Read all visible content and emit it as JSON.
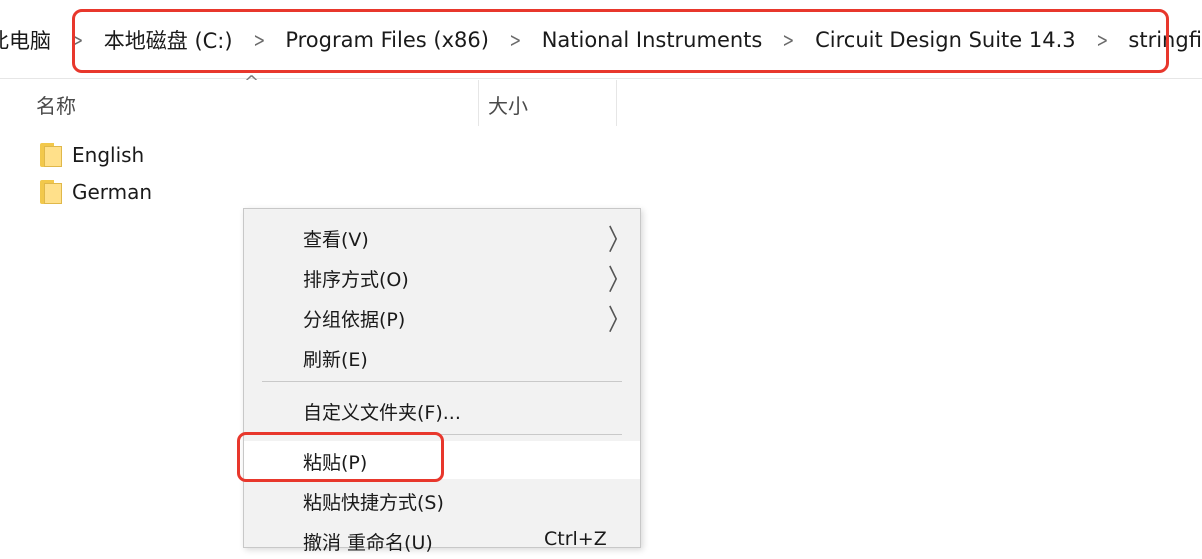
{
  "breadcrumb": {
    "items": [
      "此电脑",
      "本地磁盘 (C:)",
      "Program Files (x86)",
      "National Instruments",
      "Circuit Design Suite 14.3",
      "stringfiles"
    ],
    "separator": ">"
  },
  "columns": {
    "name": "名称",
    "size": "大小",
    "sort_indicator": "^"
  },
  "files": [
    {
      "name": "English",
      "icon": "folder-icon"
    },
    {
      "name": "German",
      "icon": "folder-icon"
    }
  ],
  "context_menu": {
    "items": [
      {
        "label": "查看(V)",
        "submenu": true,
        "submenu_glyph": "〉"
      },
      {
        "label": "排序方式(O)",
        "submenu": true,
        "submenu_glyph": "〉"
      },
      {
        "label": "分组依据(P)",
        "submenu": true,
        "submenu_glyph": "〉"
      },
      {
        "label": "刷新(E)"
      },
      {
        "label": "自定义文件夹(F)..."
      },
      {
        "label": "粘贴(P)",
        "highlighted": true
      },
      {
        "label": "粘贴快捷方式(S)"
      },
      {
        "label": "撤消 重命名(U)",
        "shortcut": "Ctrl+Z"
      }
    ]
  },
  "colors": {
    "highlight_border": "#e8372c",
    "menu_bg": "#f2f2f2",
    "folder": "#ffe08a"
  }
}
